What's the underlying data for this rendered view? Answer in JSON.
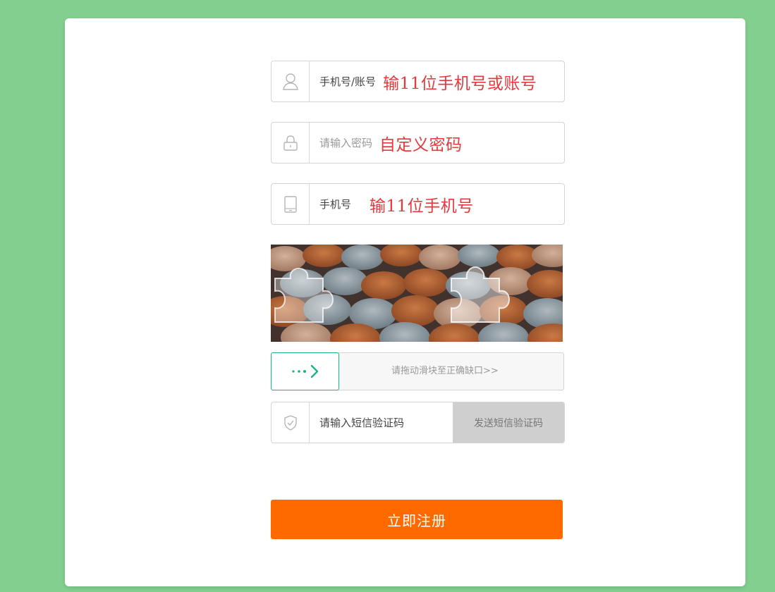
{
  "colors": {
    "background": "#82cf90",
    "accent_red": "#e8383d",
    "slider_green": "#1fb28a",
    "register_orange": "#ff6a00"
  },
  "form": {
    "account": {
      "icon": "user-icon",
      "label": "手机号/账号",
      "hint": "输11位手机号或账号"
    },
    "password": {
      "icon": "lock-icon",
      "placeholder": "请输入密码",
      "hint": "自定义密码"
    },
    "phone": {
      "icon": "tablet-icon",
      "label": "手机号",
      "hint": "输11位手机号"
    },
    "captcha": {
      "slider_icon": "dotted-arrow-right-icon",
      "slider_text": "请拖动滑块至正确缺口>>"
    },
    "sms": {
      "icon": "shield-check-icon",
      "placeholder": "请输入短信验证码",
      "send_label": "发送短信验证码"
    },
    "register_label": "立即注册"
  }
}
